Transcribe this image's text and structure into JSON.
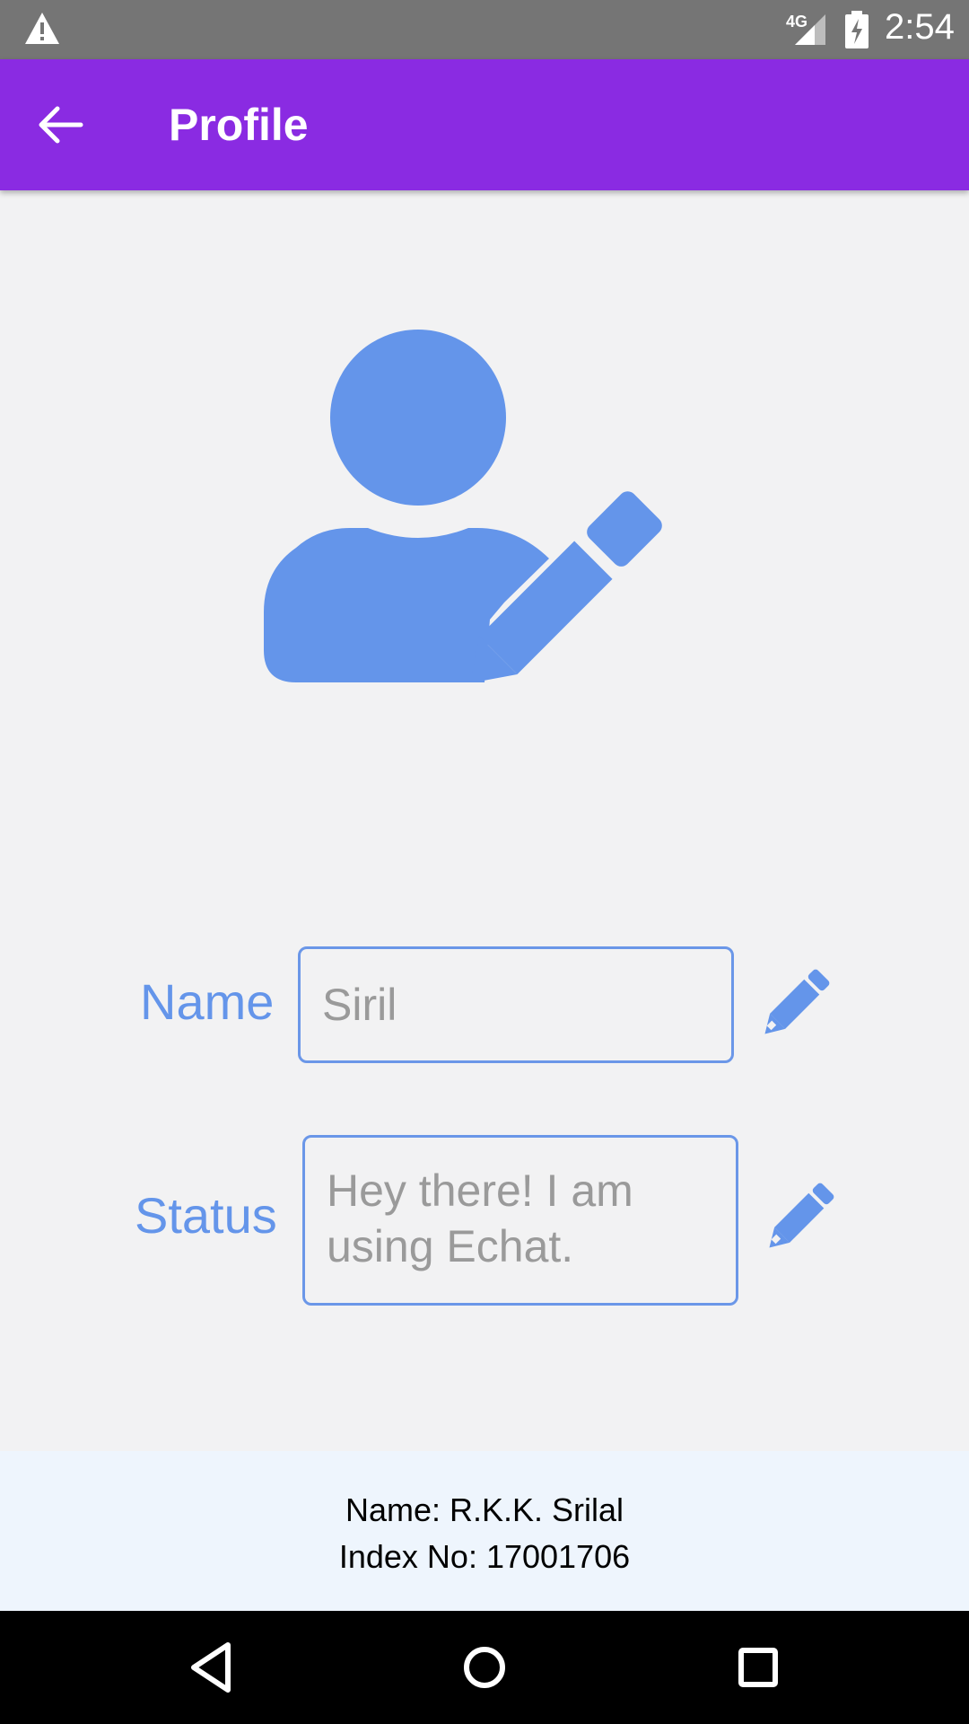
{
  "status_bar": {
    "network": "4G",
    "time": "2:54",
    "icons": [
      "warning-icon",
      "signal-icon",
      "battery-charging-icon"
    ]
  },
  "app_bar": {
    "title": "Profile",
    "back_icon": "arrow-left-icon"
  },
  "avatar": {
    "icon": "user-edit-icon",
    "color": "#6495ea"
  },
  "form": {
    "name_label": "Name",
    "name_value": "Siril",
    "status_label": "Status",
    "status_value": "Hey there! I am using Echat.",
    "edit_icon": "pencil-icon"
  },
  "footer": {
    "name_line": "Name: R.K.K. Srilal",
    "index_line": "Index No: 17001706"
  },
  "nav_bar": {
    "buttons": [
      "back-triangle-icon",
      "home-circle-icon",
      "recents-square-icon"
    ]
  },
  "colors": {
    "app_bar": "#8a2be2",
    "accent": "#6495ea",
    "status_bar": "#757575",
    "background": "#f2f2f3",
    "footer_bg": "#eef5fd"
  }
}
